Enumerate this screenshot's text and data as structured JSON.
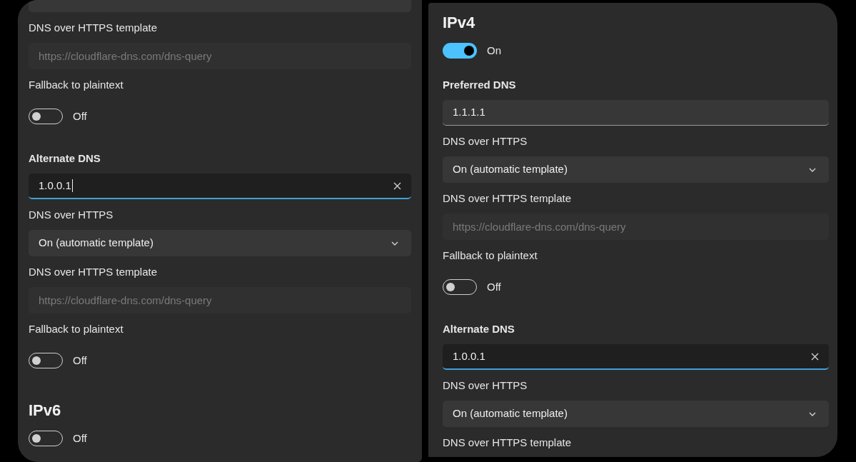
{
  "left_panel": {
    "items": [
      {
        "kind": "dropdown_cut"
      },
      {
        "kind": "label",
        "text": "DNS over HTTPS template",
        "bold": false
      },
      {
        "kind": "template",
        "placeholder": "https://cloudflare-dns.com/dns-query",
        "disabled": true
      },
      {
        "kind": "label",
        "text": "Fallback to plaintext",
        "bold": false
      },
      {
        "kind": "toggle",
        "on": false,
        "label": "Off"
      },
      {
        "kind": "label",
        "text": "Alternate DNS",
        "bold": true
      },
      {
        "kind": "textbox",
        "value": "1.0.0.1",
        "focused": true,
        "cursor": true
      },
      {
        "kind": "label",
        "text": "DNS over HTTPS",
        "bold": false
      },
      {
        "kind": "dropdown",
        "value": "On (automatic template)"
      },
      {
        "kind": "label",
        "text": "DNS over HTTPS template",
        "bold": false
      },
      {
        "kind": "template",
        "placeholder": "https://cloudflare-dns.com/dns-query",
        "disabled": true
      },
      {
        "kind": "label",
        "text": "Fallback to plaintext",
        "bold": false
      },
      {
        "kind": "toggle",
        "on": false,
        "label": "Off"
      },
      {
        "kind": "heading",
        "text": "IPv6"
      },
      {
        "kind": "toggle",
        "on": false,
        "label": "Off"
      }
    ]
  },
  "right_panel": {
    "items": [
      {
        "kind": "heading",
        "text": "IPv4"
      },
      {
        "kind": "toggle",
        "on": true,
        "label": "On"
      },
      {
        "kind": "label",
        "text": "Preferred DNS",
        "bold": true
      },
      {
        "kind": "textbox",
        "value": "1.1.1.1",
        "focused": false,
        "cursor": false
      },
      {
        "kind": "label",
        "text": "DNS over HTTPS",
        "bold": false
      },
      {
        "kind": "dropdown",
        "value": "On (automatic template)"
      },
      {
        "kind": "label",
        "text": "DNS over HTTPS template",
        "bold": false
      },
      {
        "kind": "template",
        "placeholder": "https://cloudflare-dns.com/dns-query",
        "disabled": true
      },
      {
        "kind": "label",
        "text": "Fallback to plaintext",
        "bold": false
      },
      {
        "kind": "toggle",
        "on": false,
        "label": "Off"
      },
      {
        "kind": "label",
        "text": "Alternate DNS",
        "bold": true
      },
      {
        "kind": "textbox",
        "value": "1.0.0.1",
        "focused": true,
        "cursor": false
      },
      {
        "kind": "label",
        "text": "DNS over HTTPS",
        "bold": false
      },
      {
        "kind": "dropdown",
        "value": "On (automatic template)"
      },
      {
        "kind": "label",
        "text": "DNS over HTTPS template",
        "bold": false
      }
    ]
  }
}
